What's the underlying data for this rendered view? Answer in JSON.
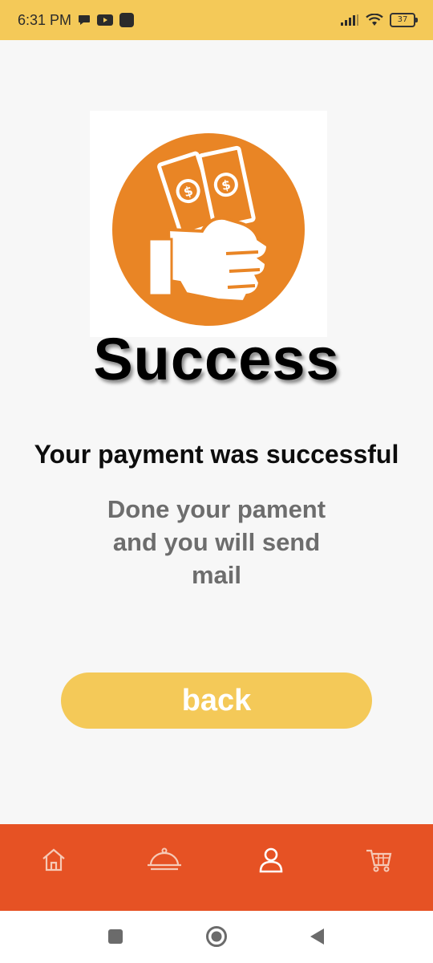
{
  "status_bar": {
    "time": "6:31 PM",
    "battery": "37",
    "icons": [
      "chat-bubble-icon",
      "youtube-icon",
      "app-icon",
      "signal-icon",
      "wifi-icon",
      "battery-icon"
    ]
  },
  "hero": {
    "icon": "money-in-hand-icon",
    "title": "Success",
    "accent_color": "#e98525"
  },
  "message": {
    "heading": "Your payment was successful",
    "subtext": "Done your pament and you will send mail"
  },
  "actions": {
    "back_label": "back"
  },
  "bottom_nav": {
    "color": "#e65224",
    "items": [
      {
        "icon": "home-icon"
      },
      {
        "icon": "food-tray-icon"
      },
      {
        "icon": "user-icon"
      },
      {
        "icon": "cart-icon"
      }
    ]
  },
  "system_nav": [
    "recents-icon",
    "home-icon",
    "back-icon"
  ]
}
